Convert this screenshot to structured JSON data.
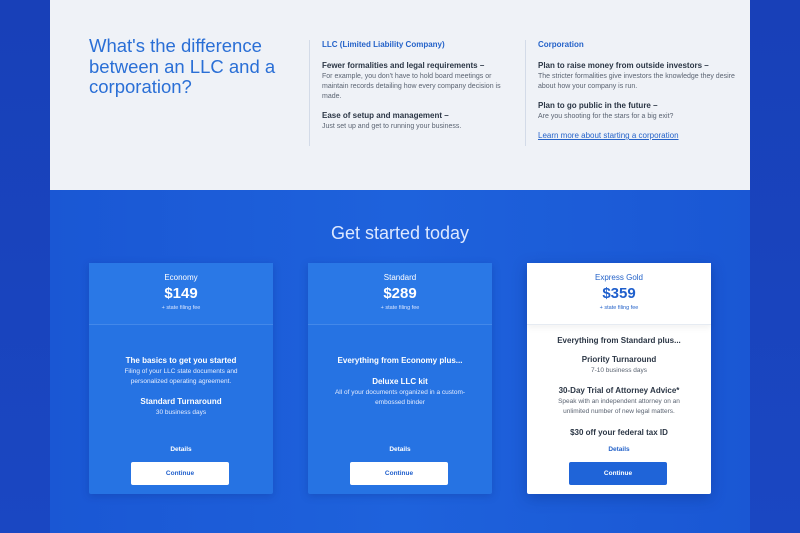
{
  "comparison": {
    "title": "What's the difference between an LLC and a corporation?",
    "llc": {
      "heading": "LLC (Limited Liability Company)",
      "items": [
        {
          "title": "Fewer formalities and legal requirements –",
          "desc": "For example, you don't have to hold board meetings or maintain records detailing how every company decision is made."
        },
        {
          "title": "Ease of setup and management –",
          "desc": "Just set up and get to running your business."
        }
      ]
    },
    "corporation": {
      "heading": "Corporation",
      "items": [
        {
          "title": "Plan to raise money from outside investors –",
          "desc": "The stricter formalities give investors the knowledge they desire about how your company is run."
        },
        {
          "title": "Plan to go public in the future –",
          "desc": "Are you shooting for the stars for a big exit?"
        }
      ],
      "link": "Learn more about starting a corporation"
    }
  },
  "pricing": {
    "title": "Get started today",
    "plans": [
      {
        "name": "Economy",
        "price": "$149",
        "fee": "+ state filing fee",
        "features": [
          {
            "title": "The basics to get you started",
            "desc": "Filing of your LLC state documents and personalized operating agreement."
          },
          {
            "title": "Standard Turnaround",
            "desc": "30 business days"
          }
        ],
        "details": "Details",
        "cta": "Continue"
      },
      {
        "name": "Standard",
        "price": "$289",
        "fee": "+ state filing fee",
        "features": [
          {
            "title": "Everything from Economy plus...",
            "desc": ""
          },
          {
            "title": "Deluxe LLC kit",
            "desc": "All of your documents organized in a custom-embossed binder"
          }
        ],
        "details": "Details",
        "cta": "Continue"
      },
      {
        "name": "Express Gold",
        "price": "$359",
        "fee": "+ state filing fee",
        "features": [
          {
            "title": "Everything from Standard plus...",
            "desc": ""
          },
          {
            "title": "Priority Turnaround",
            "desc": "7-10 business days"
          },
          {
            "title": "30-Day Trial of Attorney Advice*",
            "desc": "Speak with an independent attorney on an unlimited number of new legal matters."
          },
          {
            "title": "$30 off your federal tax ID",
            "desc": ""
          }
        ],
        "details": "Details",
        "cta": "Continue"
      }
    ]
  },
  "colors": {
    "accent": "#2563c9",
    "card_blue": "#2673e3",
    "background_blue": "#1c4fc9"
  }
}
